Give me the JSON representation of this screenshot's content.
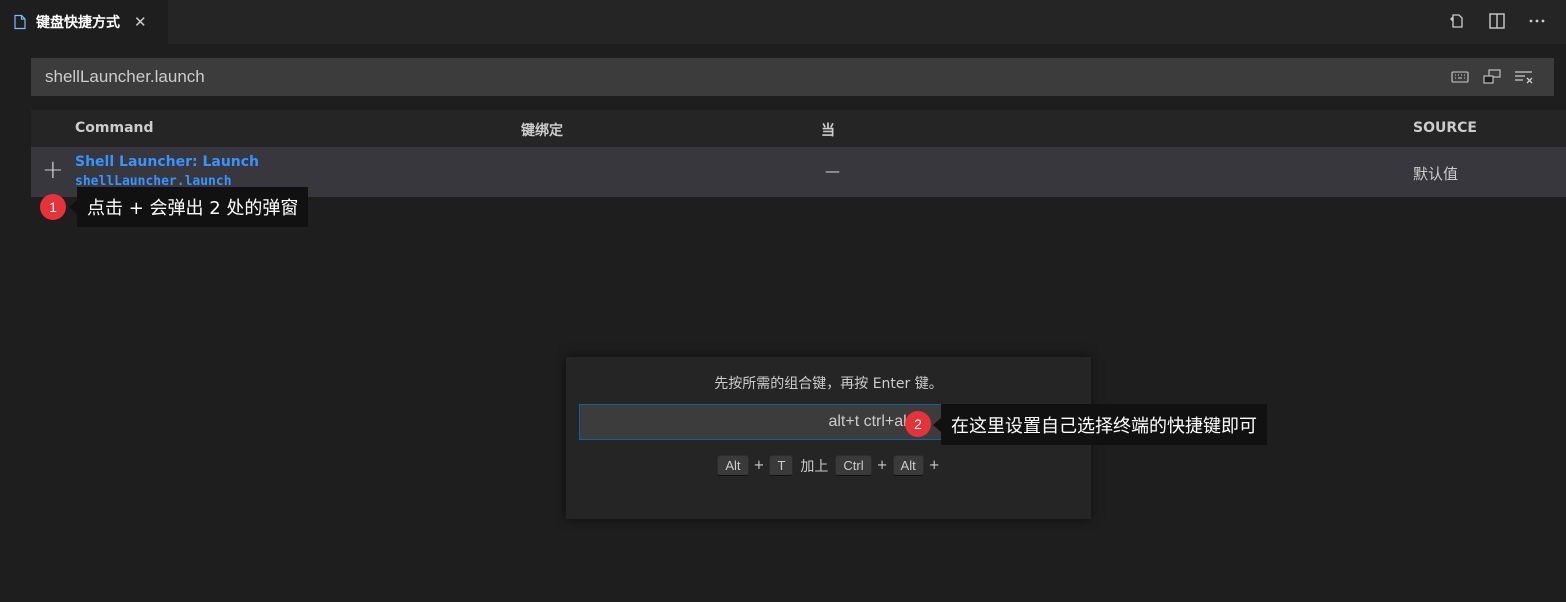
{
  "tab": {
    "title": "键盘快捷方式",
    "close": "✕"
  },
  "search": {
    "value": "shellLauncher.launch"
  },
  "table": {
    "headers": {
      "command": "Command",
      "keybinding": "键绑定",
      "when": "当",
      "source": "SOURCE"
    },
    "rows": [
      {
        "plus": "+",
        "title": "Shell Launcher: Launch",
        "id": "shellLauncher.launch",
        "when": "—",
        "source": "默认值"
      }
    ]
  },
  "annotations": [
    {
      "number": "1",
      "text": "点击 + 会弹出 2 处的弹窗"
    },
    {
      "number": "2",
      "text": "在这里设置自己选择终端的快捷键即可"
    }
  ],
  "dialog": {
    "message": "先按所需的组合键，再按 Enter 键。",
    "input_value": "alt+t ctrl+alt+",
    "chord1": [
      "Alt",
      "T"
    ],
    "plus": "+",
    "connector": "加上",
    "chord2": [
      "Ctrl",
      "Alt"
    ]
  },
  "colors": {
    "accent": "#3794ff",
    "badge": "#e8323a",
    "focus": "#0e639c"
  }
}
